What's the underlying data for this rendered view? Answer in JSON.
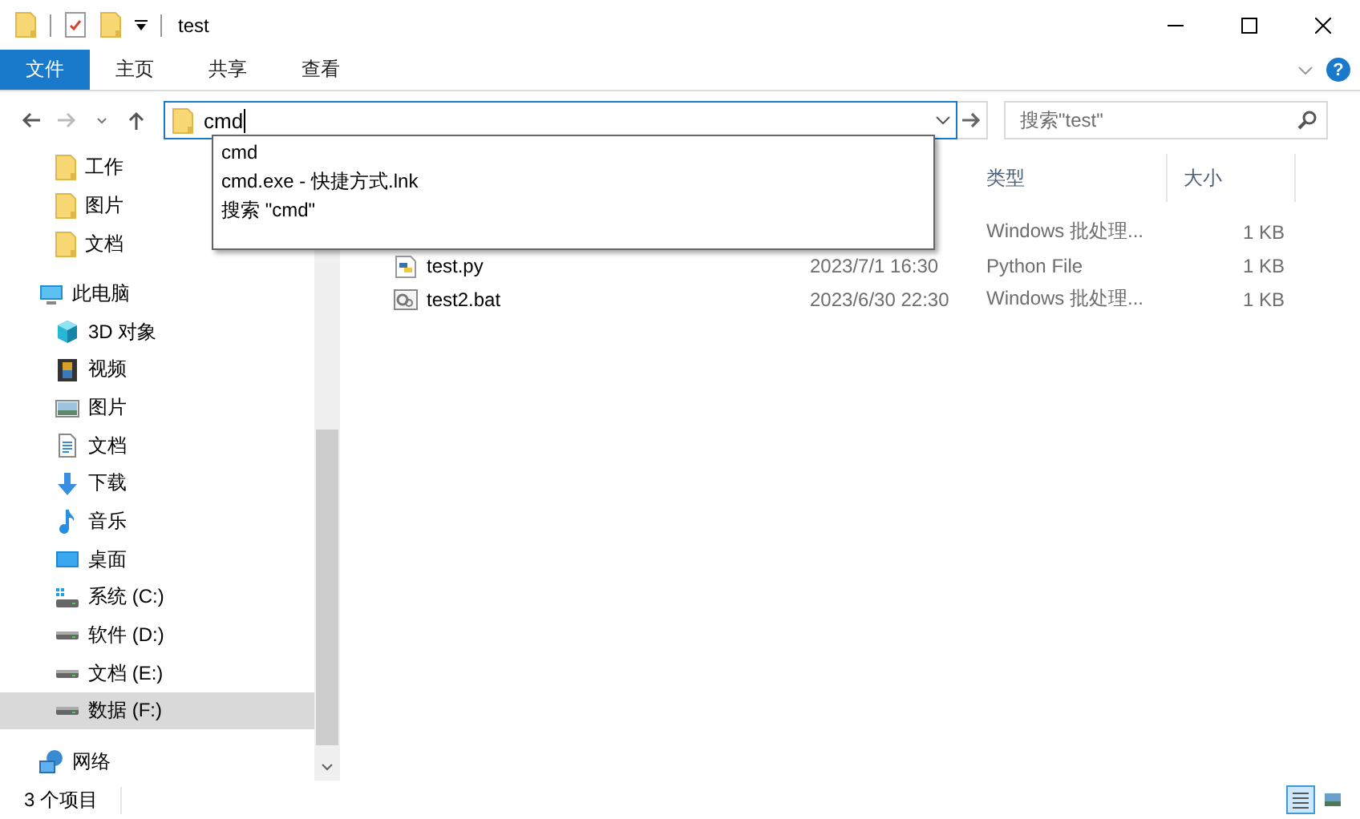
{
  "window": {
    "title": "test"
  },
  "ribbon": {
    "tabs": [
      {
        "label": "文件",
        "selected": true
      },
      {
        "label": "主页",
        "selected": false
      },
      {
        "label": "共享",
        "selected": false
      },
      {
        "label": "查看",
        "selected": false
      }
    ],
    "help": "?"
  },
  "address": {
    "value": "cmd"
  },
  "search": {
    "placeholder": "搜索\"test\""
  },
  "suggestions": [
    "cmd",
    "cmd.exe - 快捷方式.lnk",
    "搜索 \"cmd\""
  ],
  "nav": {
    "pinned": [
      {
        "label": "工作",
        "kind": "folder",
        "selected": false
      },
      {
        "label": "图片",
        "kind": "folder",
        "selected": false
      },
      {
        "label": "文档",
        "kind": "folder",
        "selected": false
      }
    ],
    "items": [
      {
        "label": "此电脑",
        "kind": "pc",
        "selected": false,
        "children": [
          {
            "label": "3D 对象",
            "kind": "cube",
            "selected": false
          },
          {
            "label": "视频",
            "kind": "video",
            "selected": false
          },
          {
            "label": "图片",
            "kind": "pictures",
            "selected": false
          },
          {
            "label": "文档",
            "kind": "document",
            "selected": false
          },
          {
            "label": "下载",
            "kind": "download",
            "selected": false
          },
          {
            "label": "音乐",
            "kind": "music",
            "selected": false
          },
          {
            "label": "桌面",
            "kind": "desktop",
            "selected": false
          },
          {
            "label": "系统 (C:)",
            "kind": "system",
            "selected": false
          },
          {
            "label": "软件 (D:)",
            "kind": "drive",
            "selected": false
          },
          {
            "label": "文档 (E:)",
            "kind": "drive",
            "selected": false
          },
          {
            "label": "数据 (F:)",
            "kind": "drive",
            "selected": true
          }
        ]
      },
      {
        "label": "网络",
        "kind": "network",
        "selected": false
      }
    ]
  },
  "table": {
    "columns": [
      {
        "label": "类型"
      },
      {
        "label": "大小"
      }
    ],
    "rows": [
      {
        "type": "Windows 批处理...",
        "size": "1 KB"
      },
      {
        "kind": "python",
        "name": "test.py",
        "date": "2023/7/1 16:30",
        "type": "Python File",
        "size": "1 KB"
      },
      {
        "kind": "bat",
        "name": "test2.bat",
        "date": "2023/6/30 22:30",
        "type": "Windows 批处理...",
        "size": "1 KB"
      }
    ]
  },
  "status_bar": {
    "count": "3 个项目",
    "views": [
      {
        "kind": "details",
        "selected": true
      },
      {
        "kind": "large",
        "selected": false
      }
    ]
  }
}
